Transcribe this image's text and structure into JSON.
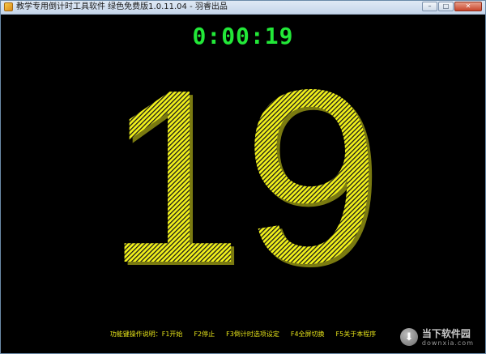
{
  "window": {
    "title": "教学专用倒计时工具软件 绿色免费版1.0.11.04 - 羽睿出品",
    "controls": {
      "minimize": "–",
      "maximize": "□",
      "close": "✕"
    }
  },
  "timer": {
    "display": "0:00:19",
    "color": "#22e838"
  },
  "big_counter": {
    "value": "19",
    "fill_color": "#f2f21a",
    "shadow_color": "#7a7a10"
  },
  "hints": {
    "items": [
      "功能键操作说明：F1开始",
      "F2停止",
      "F3倒计时选项设定",
      "F4全屏切换",
      "F5关于本程序"
    ],
    "color": "#e6e31a"
  },
  "watermark": {
    "name": "当下软件园",
    "url": "downxia.com",
    "icon": "download-arrow-icon"
  }
}
